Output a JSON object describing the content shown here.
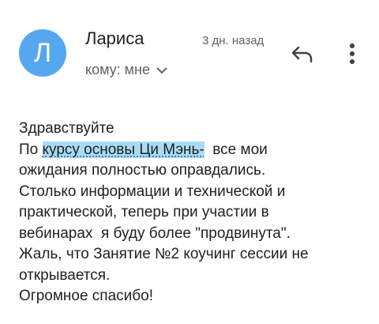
{
  "header": {
    "avatar_letter": "Л",
    "sender_name": "Лариса",
    "time": "3 дн. назад",
    "recipient": "кому: мне"
  },
  "icons": {
    "reply": "reply-icon",
    "more": "more-vert-icon",
    "expand": "chevron-down-icon"
  },
  "colors": {
    "avatar_bg": "#55a8f0",
    "highlight": "#a8dcf5"
  },
  "message": {
    "greeting": "Здравствуйте",
    "line2_prefix": "По ",
    "line2_highlight": "курсу основы Ци Мэнь-",
    "line2_suffix": "  все мои",
    "line3": "ожидания полностью оправдались.",
    "line4": "Столько информации и технической и",
    "line5": "практической, теперь при участии в",
    "line6": "вебинарах  я буду более \"продвинута\".",
    "line7": "Жаль, что Занятие №2 коучинг сессии не",
    "line8": "открывается.",
    "line9": "Огромное спасибо!"
  }
}
